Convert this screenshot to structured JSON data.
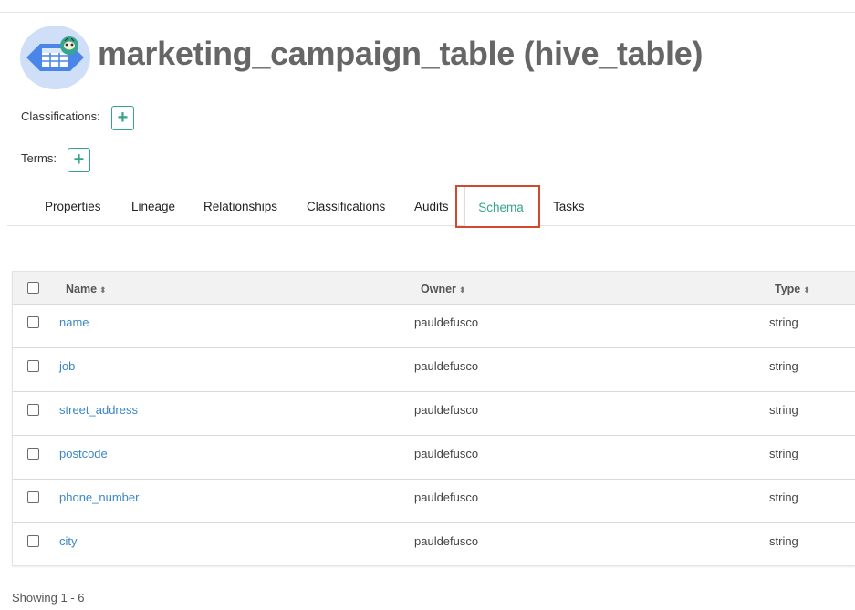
{
  "entity": {
    "title": "marketing_campaign_table (hive_table)",
    "icon": "hive-table-icon"
  },
  "classifications": {
    "label": "Classifications:",
    "add_glyph": "+"
  },
  "terms": {
    "label": "Terms:",
    "add_glyph": "+"
  },
  "tabs": [
    {
      "label": "Properties",
      "active": false
    },
    {
      "label": "Lineage",
      "active": false
    },
    {
      "label": "Relationships",
      "active": false
    },
    {
      "label": "Classifications",
      "active": false
    },
    {
      "label": "Audits",
      "active": false
    },
    {
      "label": "Schema",
      "active": true
    },
    {
      "label": "Tasks",
      "active": false
    }
  ],
  "table": {
    "columns": [
      "Name",
      "Owner",
      "Type"
    ],
    "sort_glyph": "⬍",
    "rows": [
      {
        "name": "name",
        "owner": "pauldefusco",
        "type": "string"
      },
      {
        "name": "job",
        "owner": "pauldefusco",
        "type": "string"
      },
      {
        "name": "street_address",
        "owner": "pauldefusco",
        "type": "string"
      },
      {
        "name": "postcode",
        "owner": "pauldefusco",
        "type": "string"
      },
      {
        "name": "phone_number",
        "owner": "pauldefusco",
        "type": "string"
      },
      {
        "name": "city",
        "owner": "pauldefusco",
        "type": "string"
      }
    ]
  },
  "footer": {
    "showing": "Showing 1 - 6"
  },
  "colors": {
    "accent": "#36a38a",
    "link": "#3b86c9",
    "highlight": "#d24a2e",
    "icon_bg": "#cfdff7",
    "icon_fill": "#4a86e8"
  }
}
